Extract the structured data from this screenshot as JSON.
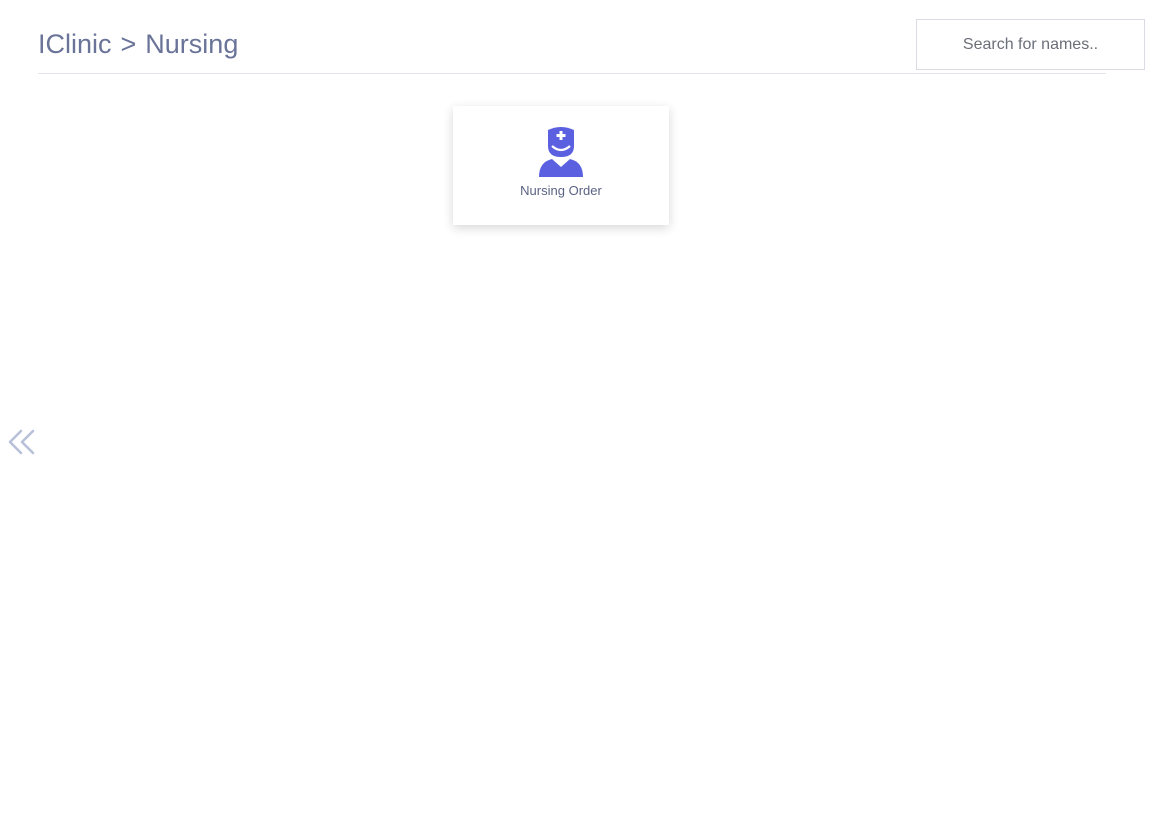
{
  "header": {
    "breadcrumb": {
      "root": "IClinic",
      "separator": ">",
      "current": "Nursing"
    },
    "search": {
      "placeholder": "Search for names.."
    }
  },
  "modules": [
    {
      "label": "Nursing Order",
      "icon": "nurse-icon"
    }
  ],
  "sidebar_toggle": {
    "icon": "double-chevron-left-icon"
  },
  "colors": {
    "accent": "#5a60df",
    "title_text": "#6a7398",
    "toggle": "#b9c1d9"
  }
}
